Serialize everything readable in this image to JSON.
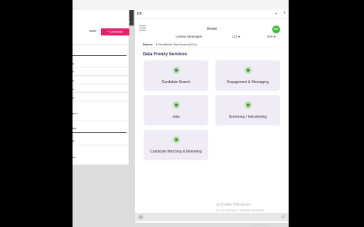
{
  "background_app": {
    "bookmark_label": "Bookmark",
    "edit_label": "EDIT",
    "pink_button_label": "+ Candidate",
    "list_partial": [
      "o",
      "o",
      "o",
      "o",
      "o",
      "o"
    ],
    "partial_text_1": "port",
    "partial_text_2": "ary",
    "partial_text_3": "d",
    "partial_text_4": "ne"
  },
  "window": {
    "title": "DF",
    "pin_icon": "pin-icon",
    "close_icon": "close-icon"
  },
  "appbar": {
    "title": "Home",
    "unread_label": "Unread Messages",
    "unread_count": "121",
    "second_count": "426",
    "avatar_initials": "DEV"
  },
  "branch": {
    "label": "Branch:",
    "value": "TempWorks Test Account (1001)"
  },
  "services": {
    "title": "Data Frenzy Services",
    "items": [
      {
        "label": "Candidate Search",
        "icon": "search-icon"
      },
      {
        "label": "Engagement & Messaging",
        "icon": "chat-icon"
      },
      {
        "label": "Jobs",
        "icon": "list-icon"
      },
      {
        "label": "Screening / Interviewing",
        "icon": "briefcase-icon"
      },
      {
        "label": "Candidate Matching & Marketing",
        "icon": "globe-icon"
      }
    ]
  },
  "watermark": {
    "line1": "Activate Windows",
    "line2": "Go to Settings to activate Windows."
  },
  "colors": {
    "accent_green": "#3fbf3a",
    "card_bg": "#f0ecf5",
    "section_title": "#2b2a57",
    "pink": "#ea1f6b"
  }
}
